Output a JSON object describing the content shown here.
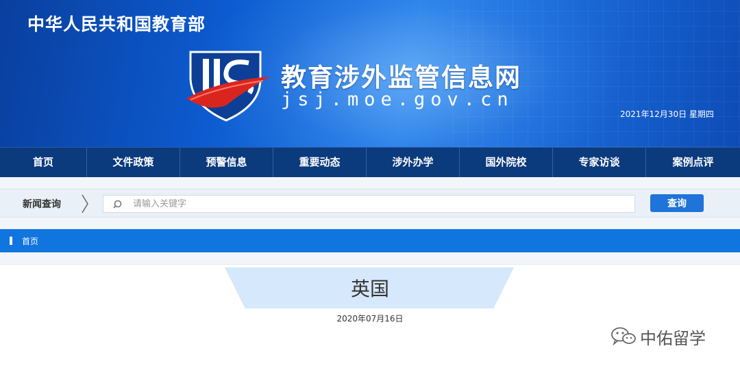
{
  "header": {
    "ministry": "中华人民共和国教育部",
    "site_title": "教育涉外监管信息网",
    "site_url": "jsj.moe.gov.cn",
    "date": "2021年12月30日  星期四",
    "logo_icon": "jsj-shield-logo-icon"
  },
  "nav": {
    "items": [
      {
        "label": "首页"
      },
      {
        "label": "文件政策"
      },
      {
        "label": "预警信息"
      },
      {
        "label": "重要动态"
      },
      {
        "label": "涉外办学"
      },
      {
        "label": "国外院校"
      },
      {
        "label": "专家访谈"
      },
      {
        "label": "案例点评"
      }
    ]
  },
  "search": {
    "label": "新闻查询",
    "placeholder": "请输入关键字",
    "value": "",
    "button_label": "查询"
  },
  "breadcrumb": {
    "home": "首页"
  },
  "article": {
    "title": "英国",
    "date": "2020年07月16日"
  },
  "watermark": {
    "text": "中佑留学",
    "icon": "wechat-icon"
  },
  "colors": {
    "nav_bg": "#0b3a7d",
    "accent": "#1175e0",
    "button": "#1f73d9",
    "title_tab": "#d6e8fb"
  }
}
